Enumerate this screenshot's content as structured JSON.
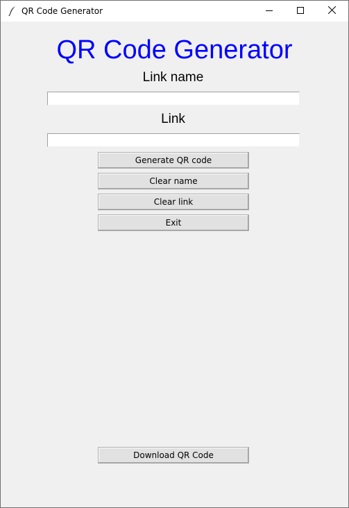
{
  "window": {
    "title": "QR Code Generator"
  },
  "main": {
    "heading": "QR Code Generator",
    "link_name_label": "Link name",
    "link_name_value": "",
    "link_label": "Link",
    "link_value": ""
  },
  "buttons": {
    "generate": "Generate QR code",
    "clear_name": "Clear name",
    "clear_link": "Clear link",
    "exit": "Exit",
    "download": "Download QR Code"
  },
  "colors": {
    "heading": "#0000ff",
    "background": "#f0f0f0"
  }
}
